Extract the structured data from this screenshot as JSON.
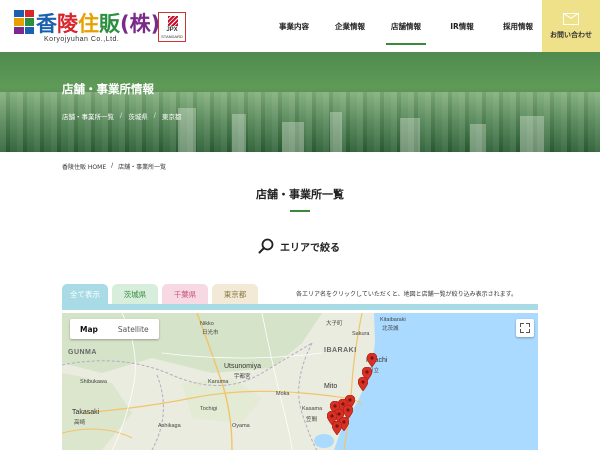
{
  "header": {
    "logo_text": "香陵住販(株)",
    "logo_sub": "Koryojyuhan Co.,Ltd.",
    "jpx_top": "JPX",
    "jpx_bottom": "STANDARD",
    "nav": [
      {
        "label": "事業内容"
      },
      {
        "label": "企業情報"
      },
      {
        "label": "店舗情報"
      },
      {
        "label": "IR情報"
      },
      {
        "label": "採用情報"
      }
    ],
    "contact_label": "お問い合わせ"
  },
  "hero": {
    "title": "店舗・事業所情報",
    "links": [
      "店舗・事業所一覧",
      "茨城県",
      "東京都"
    ]
  },
  "breadcrumb": {
    "home": "香陵住販 HOME",
    "sep": "/",
    "current": "店舗・事業所一覧"
  },
  "section": {
    "title": "店舗・事業所一覧",
    "search_label": "エリアで絞る"
  },
  "tabs": [
    {
      "label": "全て表示"
    },
    {
      "label": "茨城県"
    },
    {
      "label": "千葉県"
    },
    {
      "label": "東京都"
    }
  ],
  "filter_note": "各エリア名をクリックしていただくと、地図と店舗一覧が絞り込み表示されます。",
  "map": {
    "map_button": "Map",
    "satellite_button": "Satellite",
    "labels": {
      "nikko": "Nikko",
      "nikko_jp": "日光市",
      "utsunomiya": "Utsunomiya",
      "utsunomiya_jp": "宇都宮",
      "gunma": "GUNMA",
      "ibaraki": "IBARAKI",
      "hitachi": "Hitachi",
      "hitachi_jp": "日立",
      "takasaki": "Takasaki",
      "takasaki_jp": "高崎",
      "kitaibaraki": "Kitaibaraki",
      "kitaibaraki_jp": "北茨城",
      "shibukawa": "Shibukawa",
      "kanuma": "Kanuma",
      "moka": "Moka",
      "oyama": "Oyama",
      "mito": "Mito",
      "kasama": "Kasama",
      "tochigi": "Tochigi",
      "ashikaga": "Ashikaga",
      "sakura": "Sakura",
      "oyama_jp": "大子町",
      "kasama_jp": "笠間"
    }
  },
  "colors": {
    "accent_green": "#3a8a3c",
    "contact_bg": "#efe08a",
    "tab_all": "#a9dbe6",
    "pin_red": "#d93025"
  }
}
